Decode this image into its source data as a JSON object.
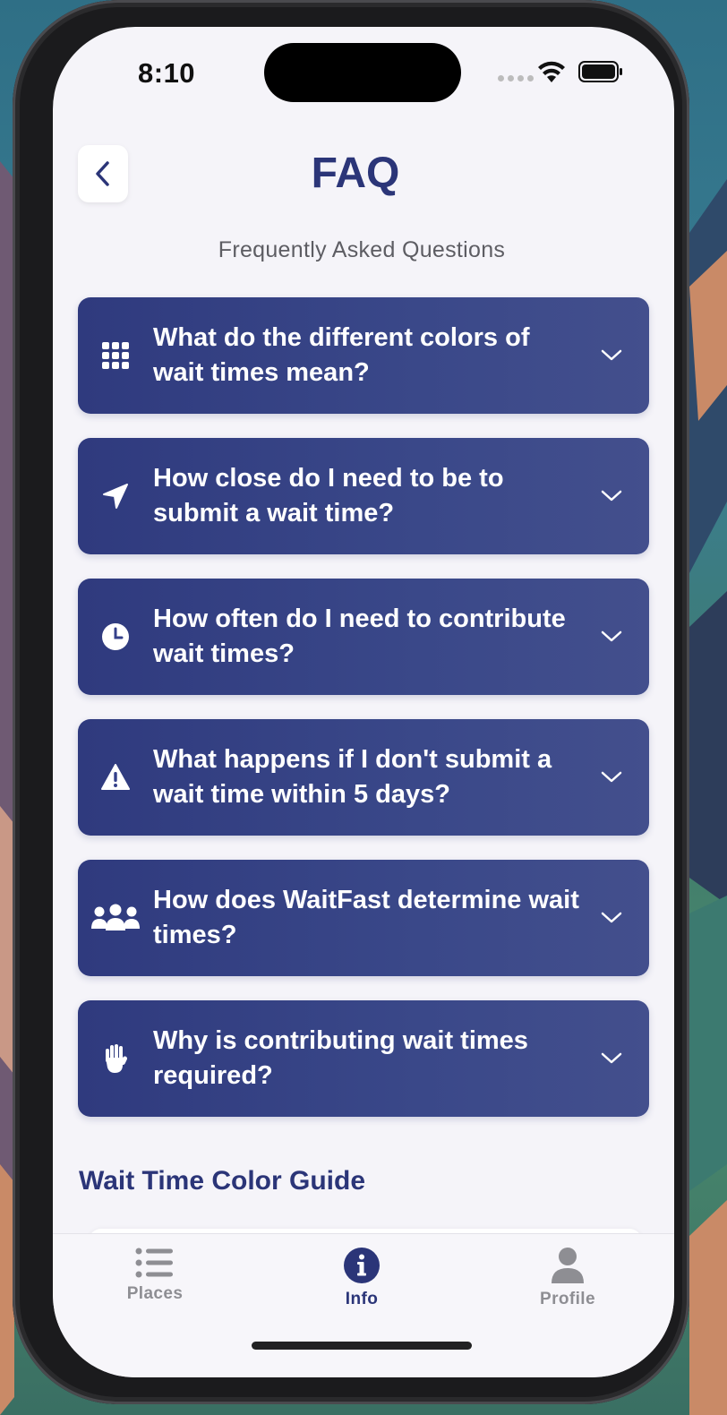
{
  "status_bar": {
    "time": "8:10"
  },
  "header": {
    "back_icon": "chevron-left-icon",
    "title": "FAQ",
    "subtitle": "Frequently Asked Questions"
  },
  "faq": [
    {
      "icon": "grid-dots-icon",
      "question": "What do the different colors of wait times mean?"
    },
    {
      "icon": "location-arrow-icon",
      "question": "How close do I need to be to submit a wait time?"
    },
    {
      "icon": "clock-icon",
      "question": "How often do I need to contribute wait times?"
    },
    {
      "icon": "warning-icon",
      "question": "What happens if I don't submit a wait time within 5 days?"
    },
    {
      "icon": "users-icon",
      "question": "How does WaitFast determine wait times?"
    },
    {
      "icon": "hand-icon",
      "question": "Why is contributing wait times required?"
    }
  ],
  "color_guide": {
    "title": "Wait Time Color Guide"
  },
  "tabs": [
    {
      "icon": "list-icon",
      "label": "Places",
      "active": false
    },
    {
      "icon": "info-icon",
      "label": "Info",
      "active": true
    },
    {
      "icon": "person-icon",
      "label": "Profile",
      "active": false
    }
  ],
  "colors": {
    "accent": "#2b3578",
    "card_gradient_start": "#2f3a7e",
    "card_gradient_end": "#434f8d",
    "tab_inactive": "#8e8e93",
    "background": "#f5f4f9"
  }
}
